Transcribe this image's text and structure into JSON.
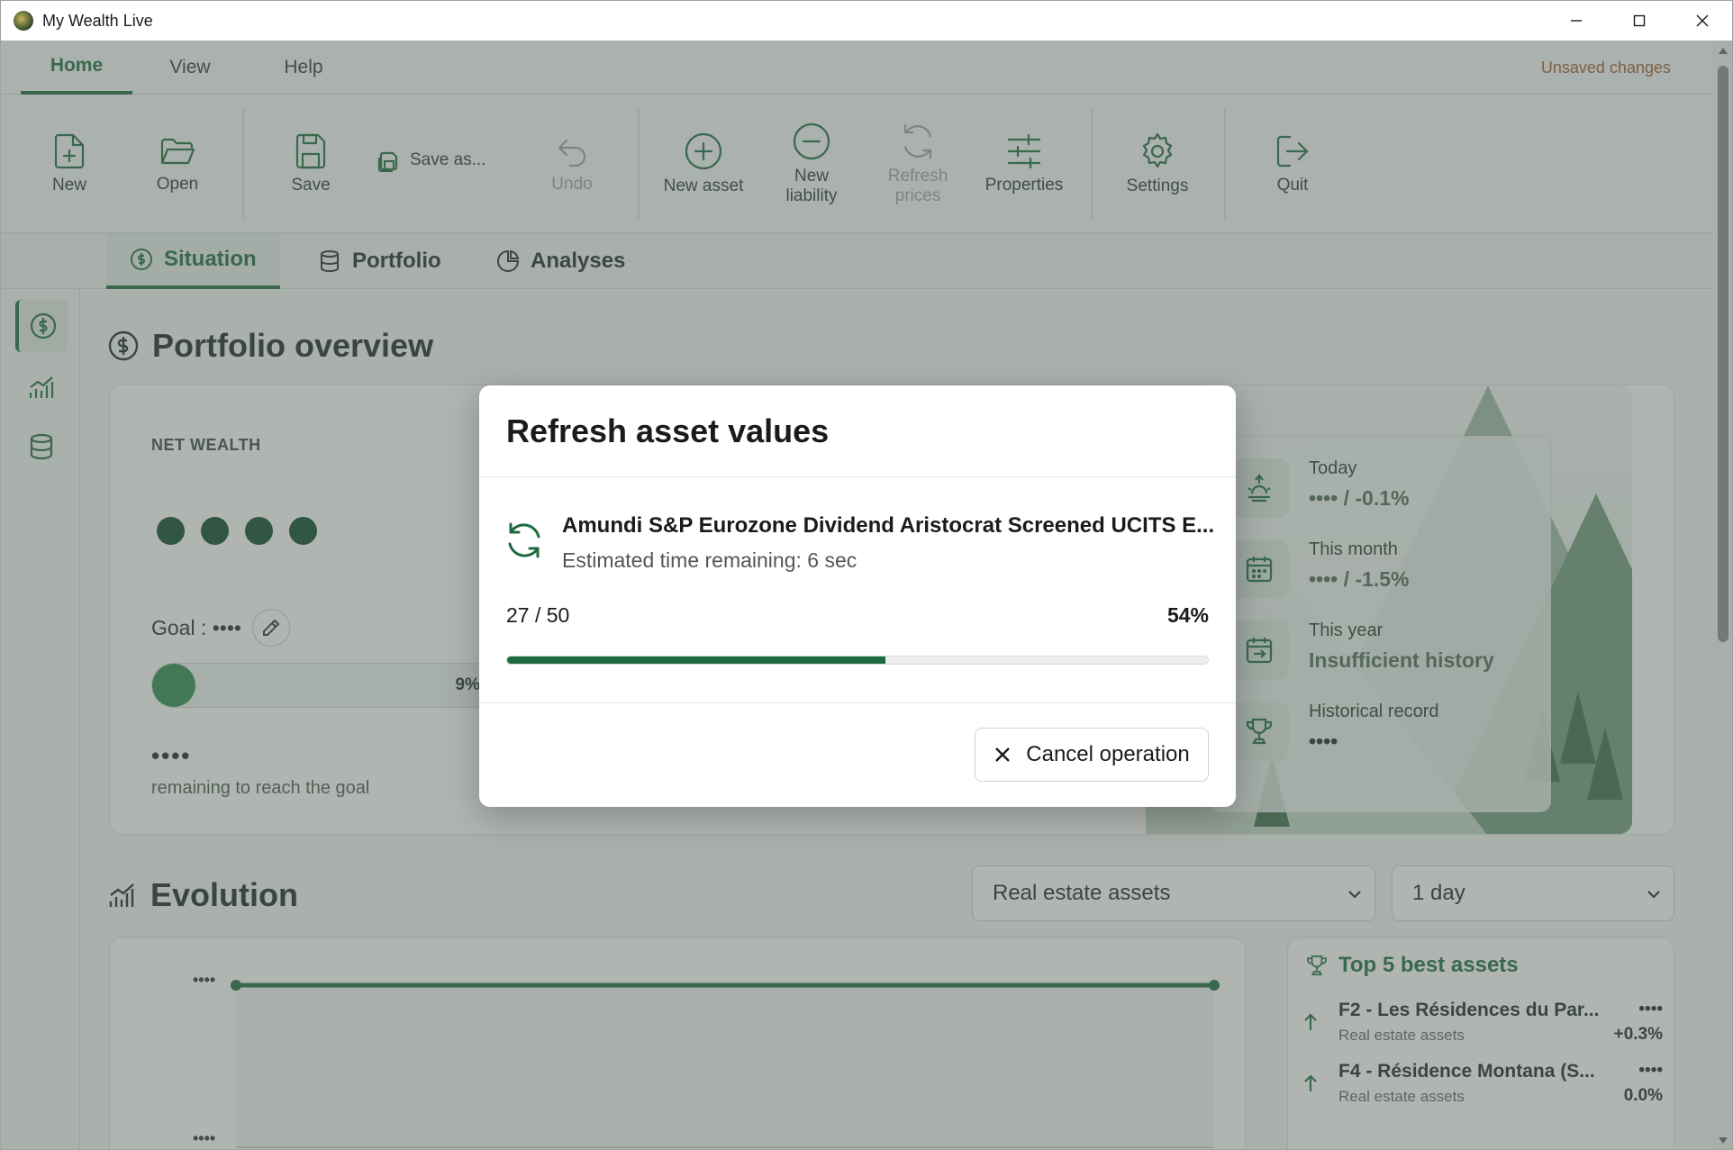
{
  "window": {
    "title": "My Wealth Live"
  },
  "ribbon": {
    "tabs": [
      {
        "label": "Home"
      },
      {
        "label": "View"
      },
      {
        "label": "Help"
      }
    ],
    "status": "Unsaved changes"
  },
  "toolbar": {
    "new": "New",
    "open": "Open",
    "save": "Save",
    "save_as": "Save as...",
    "undo": "Undo",
    "new_asset": "New asset",
    "new_liability": "New liability",
    "refresh_prices": "Refresh prices",
    "properties": "Properties",
    "settings": "Settings",
    "quit": "Quit"
  },
  "page_tabs": [
    {
      "label": "Situation"
    },
    {
      "label": "Portfolio"
    },
    {
      "label": "Analyses"
    }
  ],
  "overview": {
    "title": "Portfolio overview",
    "net_wealth_label": "NET WEALTH",
    "goal_label": "Goal : ••••",
    "goal_progress_pct": 9,
    "goal_progress_label": "9%",
    "remaining_value": "••••",
    "remaining_label": "remaining to reach the goal",
    "stats": [
      {
        "label": "Today",
        "value": "•••• / -0.1%"
      },
      {
        "label": "This month",
        "value": "•••• / -1.5%"
      },
      {
        "label": "This year",
        "value": "Insufficient history"
      },
      {
        "label": "Historical record",
        "value": "••••"
      }
    ]
  },
  "evolution": {
    "title": "Evolution",
    "category_select": "Real estate assets",
    "period_select": "1 day",
    "y_top_label": "••••",
    "y_bottom_label": "••••"
  },
  "top5": {
    "title": "Top 5 best assets",
    "items": [
      {
        "name": "F2 - Les Résidences du Par...",
        "category": "Real estate assets",
        "value": "••••",
        "change": "+0.3%"
      },
      {
        "name": "F4 - Résidence Montana (S...",
        "category": "Real estate assets",
        "value": "••••",
        "change": "0.0%"
      }
    ]
  },
  "modal": {
    "title": "Refresh asset values",
    "asset_name": "Amundi S&P Eurozone Dividend Aristocrat Screened UCITS E...",
    "eta": "Estimated time remaining: 6 sec",
    "count": "27 / 50",
    "progress_pct": 54,
    "progress_label": "54%",
    "cancel_label": "Cancel operation"
  },
  "colors": {
    "accent": "#1e6b3f",
    "warning": "#a35a2b"
  }
}
